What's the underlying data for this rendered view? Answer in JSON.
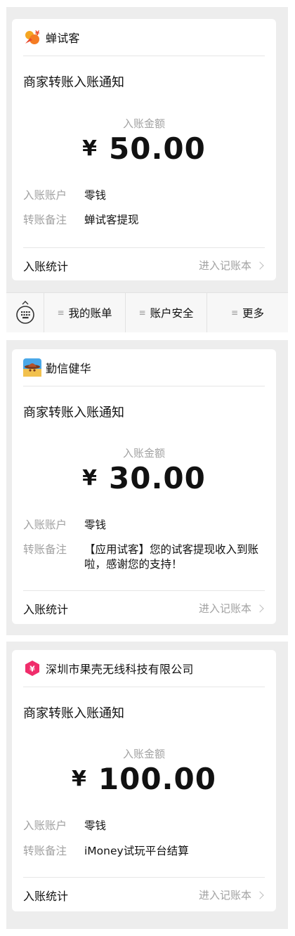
{
  "yen_symbol": "¥",
  "menu_bar": {
    "items": [
      {
        "glyph": "≡",
        "label": "我的账单"
      },
      {
        "glyph": "≡",
        "label": "账户安全"
      },
      {
        "glyph": "≡",
        "label": "更多"
      }
    ]
  },
  "cards": [
    {
      "merchant_name": "蝉试客",
      "notice_title": "商家转账入账通知",
      "amount_label": "入账金额",
      "amount": "50.00",
      "account_label": "入账账户",
      "account_value": "零钱",
      "remark_label": "转账备注",
      "remark_value": "蝉试客提现",
      "footer_left": "入账统计",
      "footer_right": "进入记账本",
      "logo_color": "#f5a623"
    },
    {
      "merchant_name": "勤信健华",
      "notice_title": "商家转账入账通知",
      "amount_label": "入账金额",
      "amount": "30.00",
      "account_label": "入账账户",
      "account_value": "零钱",
      "remark_label": "转账备注",
      "remark_value": "【应用试客】您的试客提现收入到账啦，感谢您的支持！",
      "footer_left": "入账统计",
      "footer_right": "进入记账本",
      "logo_color": "#4aa8e8"
    },
    {
      "merchant_name": "深圳市果壳无线科技有限公司",
      "notice_title": "商家转账入账通知",
      "amount_label": "入账金额",
      "amount": "100.00",
      "account_label": "入账账户",
      "account_value": "零钱",
      "remark_label": "转账备注",
      "remark_value": "iMoney试玩平台结算",
      "footer_left": "入账统计",
      "footer_right": "进入记账本",
      "logo_color": "#f02d6b"
    }
  ]
}
